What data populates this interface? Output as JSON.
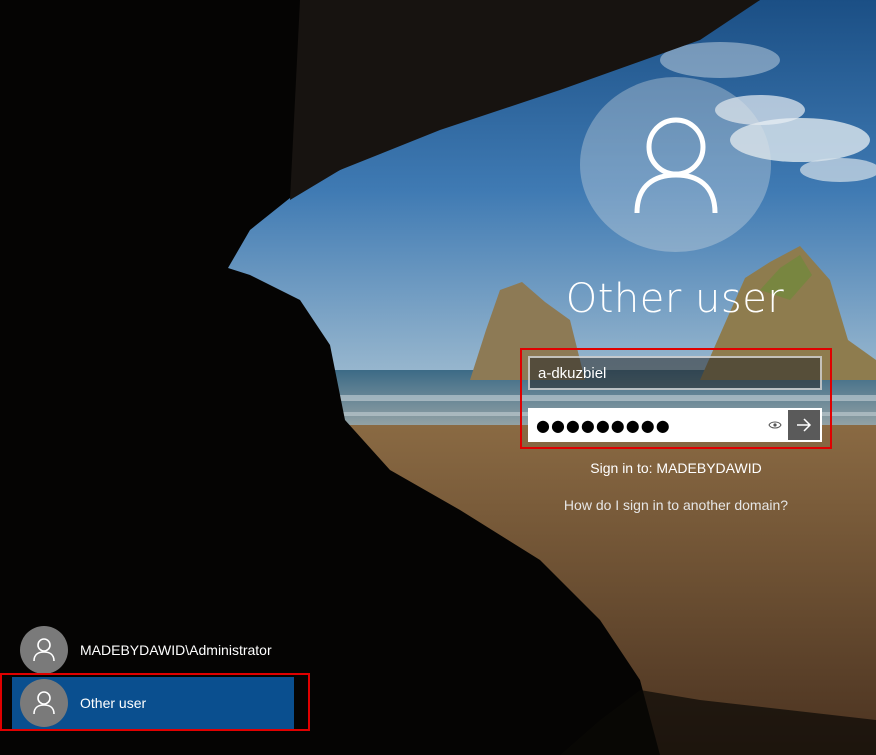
{
  "login": {
    "display_name": "Other user",
    "username_value": "a-dkuzbiel",
    "password_masked": "●●●●●●●●●",
    "sign_in_to": "Sign in to: MADEBYDAWID",
    "help_link": "How do I sign in to another domain?"
  },
  "users": [
    {
      "label": "MADEBYDAWID\\Administrator",
      "icon": "user-icon"
    },
    {
      "label": "Other user",
      "icon": "user-icon",
      "selected": true
    }
  ],
  "icons": {
    "reveal": "eye-icon",
    "submit": "arrow-right-icon",
    "avatar": "user-icon"
  },
  "colors": {
    "highlight": "#e00000",
    "selected_tile": "#0a4f8f",
    "submit_button": "#5a5a5a"
  }
}
